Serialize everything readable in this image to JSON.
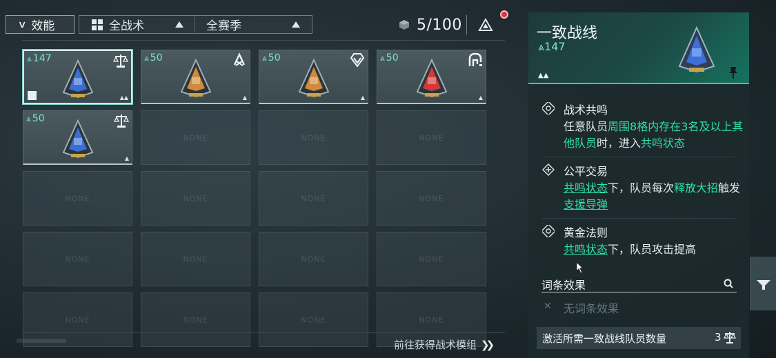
{
  "toolbar": {
    "filter_label": "效能",
    "tactic_select": "全战术",
    "season_select": "全赛季",
    "capacity": "5/100"
  },
  "grid": {
    "cards": [
      {
        "value": "147",
        "icon": "scales-icon",
        "color": "#3a6fd4",
        "selected": true
      },
      {
        "value": "50",
        "icon": "crossed-tools-icon",
        "color": "#d08a3a",
        "selected": false
      },
      {
        "value": "50",
        "icon": "diamond-shield-icon",
        "color": "#d08a3a",
        "selected": false
      },
      {
        "value": "50",
        "icon": "arch-logo-icon",
        "color": "#d23a3a",
        "selected": false
      },
      {
        "value": "50",
        "icon": "scales-icon",
        "color": "#3a6fd4",
        "selected": false
      }
    ],
    "empty_label": "NONE"
  },
  "footer": {
    "link_label": "前往获得战术模组"
  },
  "detail": {
    "title": "一致战线",
    "value": "147",
    "skills": [
      {
        "name": "战术共鸣",
        "desc_parts": [
          "任意队员",
          "周围8格内存在3名及以上其他队员",
          "时，进入",
          "共鸣状态"
        ]
      },
      {
        "name": "公平交易",
        "desc_parts": [
          "共鸣状态",
          "下，队员每次",
          "释放大招",
          "触发",
          "支援导弹"
        ]
      },
      {
        "name": "黄金法则",
        "desc_parts": [
          "共鸣状态",
          "下，队员攻击提高"
        ]
      }
    ],
    "attributes_label": "词条效果",
    "no_attributes": "无词条效果",
    "requirement_label": "激活所需一致战线队员数量",
    "requirement_count": "3"
  },
  "colors": {
    "accent": "#2fe0a5",
    "value": "#77e8d4",
    "notification": "#e03341"
  }
}
